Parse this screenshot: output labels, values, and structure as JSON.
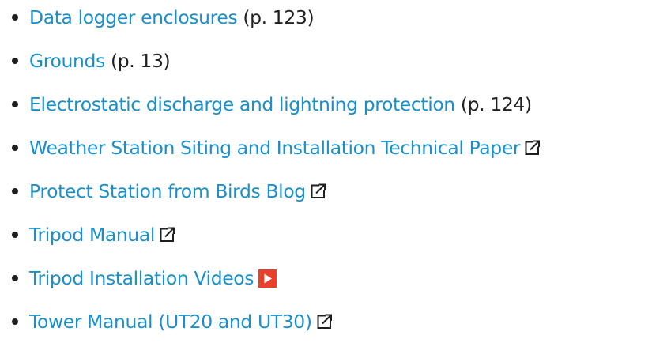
{
  "links": [
    {
      "text": "Data logger enclosures",
      "page_ref": "(p. 123)"
    },
    {
      "text": "Grounds",
      "page_ref": "(p. 13)"
    },
    {
      "text": "Electrostatic discharge and lightning protection",
      "page_ref": "(p. 124)"
    },
    {
      "text": "Weather Station Siting and Installation Technical Paper",
      "icon": "external-link-icon"
    },
    {
      "text": "Protect Station from Birds Blog",
      "icon": "external-link-icon"
    },
    {
      "text": "Tripod Manual",
      "icon": "external-link-icon"
    },
    {
      "text": "Tripod Installation Videos",
      "icon": "video-play-icon"
    },
    {
      "text": "Tower Manual (UT20 and UT30)",
      "icon": "external-link-icon"
    }
  ],
  "colors": {
    "link": "#1a8fc9",
    "text": "#1f1f1f",
    "video_icon_bg": "#e8402a"
  }
}
